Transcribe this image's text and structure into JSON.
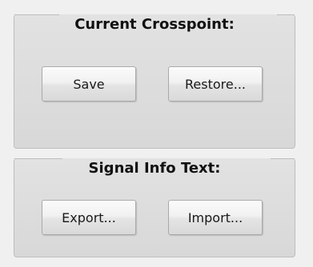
{
  "crosspoint_group": {
    "title": "Current Crosspoint:",
    "save_label": "Save",
    "restore_label": "Restore..."
  },
  "signal_info_group": {
    "title": "Signal Info Text:",
    "export_label": "Export...",
    "import_label": "Import..."
  }
}
